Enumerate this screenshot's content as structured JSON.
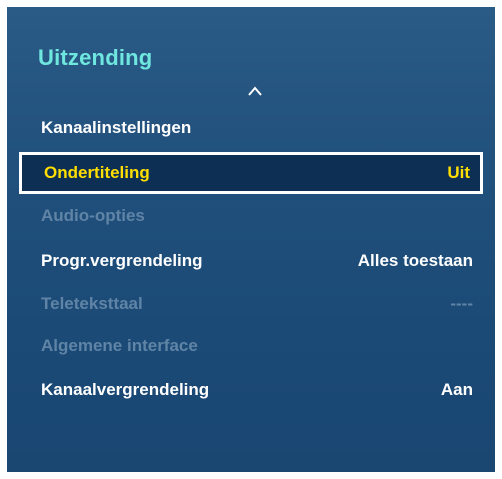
{
  "menu": {
    "title": "Uitzending",
    "scroll_up_icon": "chevron-up-icon",
    "items": [
      {
        "label": "Kanaalinstellingen",
        "value": "",
        "state": "enabled"
      },
      {
        "label": "Ondertiteling",
        "value": "Uit",
        "state": "focused"
      },
      {
        "label": "Audio-opties",
        "value": "",
        "state": "disabled"
      },
      {
        "label": "Progr.vergrendeling",
        "value": "Alles toestaan",
        "state": "enabled"
      },
      {
        "label": "Teleteksttaal",
        "value": "----",
        "state": "disabled"
      },
      {
        "label": "Algemene interface",
        "value": "",
        "state": "disabled"
      },
      {
        "label": "Kanaalvergrendeling",
        "value": "Aan",
        "state": "enabled"
      }
    ]
  },
  "colors": {
    "title": "#6fe7df",
    "focused_text": "#ffde00",
    "disabled_text": "#5f84a6",
    "panel_background": "#21507c",
    "focus_background": "#0d2f53"
  }
}
